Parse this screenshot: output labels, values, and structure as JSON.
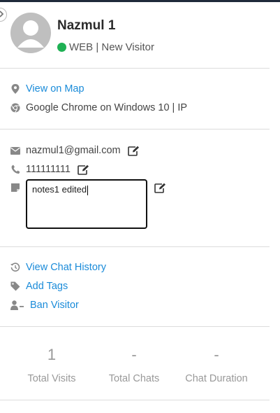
{
  "visitor": {
    "name": "Nazmul 1",
    "status": "WEB | New Visitor",
    "online_color": "#1fb154"
  },
  "location": {
    "map_link": "View on Map",
    "browser": "Google Chrome on Windows 10 | IP"
  },
  "contact": {
    "email": "nazmul1@gmail.com",
    "phone": "111111111",
    "notes": "notes1 edited"
  },
  "actions": {
    "history": "View Chat History",
    "tags": "Add Tags",
    "ban": "Ban Visitor"
  },
  "stats": [
    {
      "value": "1",
      "label": "Total Visits"
    },
    {
      "value": "-",
      "label": "Total Chats"
    },
    {
      "value": "-",
      "label": "Chat Duration"
    }
  ],
  "icons": {
    "collapse": "chevron-right-icon",
    "map": "map-marker-icon",
    "browser": "chrome-icon",
    "email": "envelope-icon",
    "phone": "phone-icon",
    "notes": "sticky-note-icon",
    "edit": "edit-icon",
    "history": "history-icon",
    "tags": "tag-icon",
    "ban": "user-minus-icon"
  },
  "colors": {
    "link": "#1a8bd9",
    "muted": "#999999"
  }
}
